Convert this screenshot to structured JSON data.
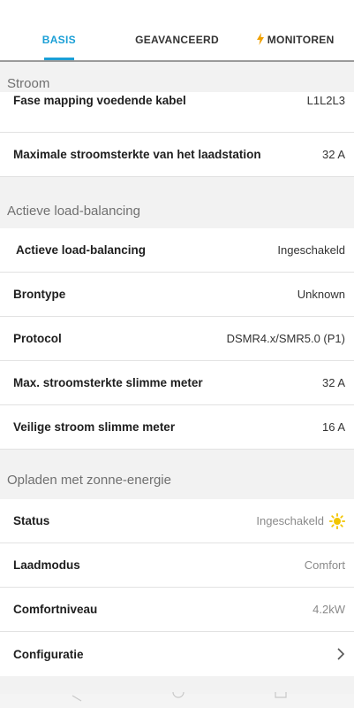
{
  "tabs": [
    {
      "label": "BASIS",
      "active": true
    },
    {
      "label": "GEAVANCEERD",
      "active": false
    },
    {
      "label": "MONITOREN",
      "active": false,
      "icon": "lightning-icon"
    }
  ],
  "colors": {
    "accent": "#1a9fd6",
    "bolt": "#f0a000",
    "sun": "#f2c500"
  },
  "sections": [
    {
      "title": "Stroom",
      "rows": [
        {
          "label": "Fase mapping voedende kabel",
          "value": "L1L2L3"
        },
        {
          "label": "Maximale stroomsterkte van het laadstation",
          "value": "32 A"
        }
      ]
    },
    {
      "title": "Actieve load-balancing",
      "rows": [
        {
          "label": "Actieve load-balancing",
          "value": "Ingeschakeld"
        },
        {
          "label": "Brontype",
          "value": "Unknown"
        },
        {
          "label": "Protocol",
          "value": "DSMR4.x/SMR5.0 (P1)"
        },
        {
          "label": "Max. stroomsterkte slimme meter",
          "value": "32 A"
        },
        {
          "label": "Veilige stroom slimme meter",
          "value": "16 A"
        }
      ]
    },
    {
      "title": "Opladen met zonne-energie",
      "rows": [
        {
          "label": "Status",
          "value": "Ingeschakeld",
          "icon": "sun-icon"
        },
        {
          "label": "Laadmodus",
          "value": "Comfort"
        },
        {
          "label": "Comfortniveau",
          "value": "4.2kW"
        },
        {
          "label": "Configuratie",
          "value": "",
          "icon": "chevron-right-icon"
        }
      ]
    }
  ]
}
